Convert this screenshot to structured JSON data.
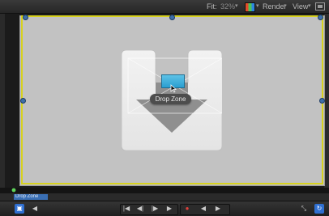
{
  "header": {
    "fit_label": "Fit:",
    "fit_value": "32%",
    "render_label": "Render",
    "view_label": "View",
    "chevron": "▾"
  },
  "canvas": {
    "drop_zone_label": "Drop Zone"
  },
  "timeline": {
    "clip_label": "Drop Zone"
  },
  "transport": {
    "go_start": "|◀",
    "prev_frame": "◀|",
    "next_frame": "|▶",
    "play": "▶",
    "record": "●",
    "back": "◀",
    "forward": "▶",
    "loop": "↻",
    "left_btn": "◀"
  },
  "colors": {
    "canvas_border": "#d7d11f",
    "handle": "#3d6fa8",
    "accent_blue": "#2f6fd1"
  }
}
